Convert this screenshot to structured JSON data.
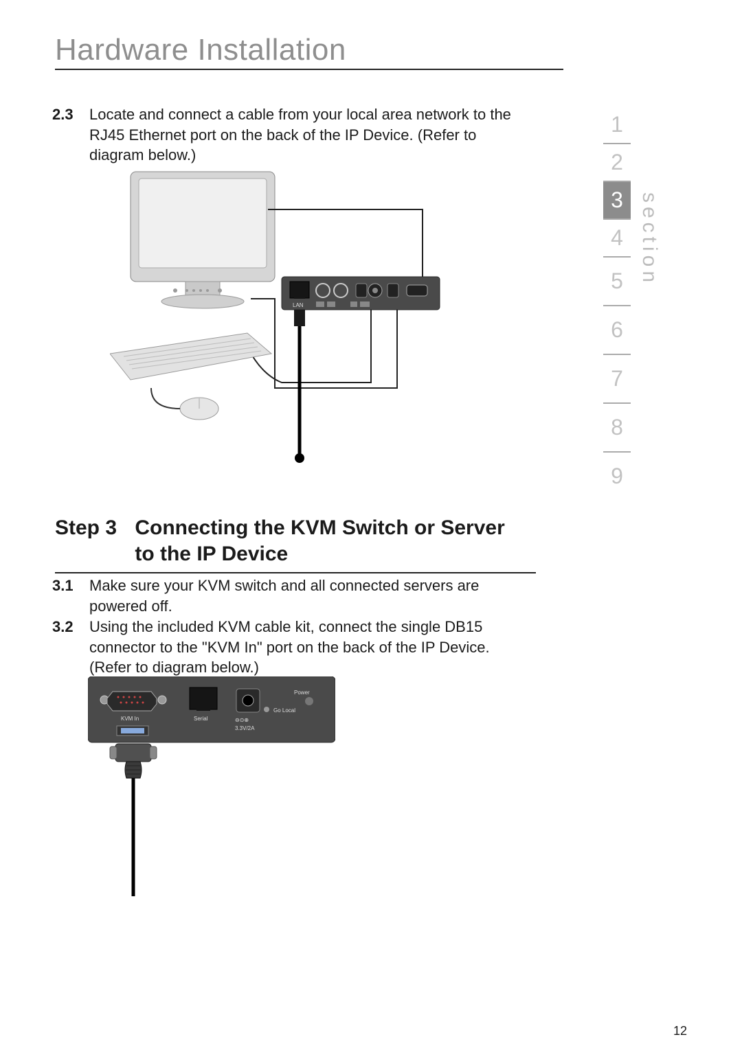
{
  "title": "Hardware Installation",
  "paragraphs": {
    "p1_num": "2.3",
    "p1_text": "Locate and connect a cable from your local area network to the RJ45 Ethernet port on the back of the IP Device. (Refer to diagram below.)",
    "p2_num": "3.1",
    "p2_text": "Make sure your KVM switch and all connected servers are powered off.",
    "p3_num": "3.2",
    "p3_text": "Using the included KVM cable kit, connect the single DB15 connector to the \"KVM In\" port on the back of the IP Device. (Refer to diagram below.)"
  },
  "step": {
    "label": "Step 3",
    "title": "Connecting the KVM Switch or Server to the IP Device"
  },
  "nav": {
    "items": [
      "1",
      "2",
      "3",
      "4",
      "5",
      "6",
      "7",
      "8",
      "9"
    ],
    "active_index": 2,
    "side_label": "section"
  },
  "page_number": "12",
  "diagram1": {
    "components": [
      "monitor",
      "keyboard",
      "mouse",
      "ip-device-rear",
      "ethernet-cable"
    ],
    "rear_port_labels": [
      "LAN"
    ]
  },
  "diagram2": {
    "components": [
      "ip-device-rear",
      "kvm-cable",
      "db15-connector"
    ],
    "rear_port_labels": [
      "KVM In",
      "Serial",
      "Go Local",
      "Power",
      "3.3V/2A"
    ]
  }
}
